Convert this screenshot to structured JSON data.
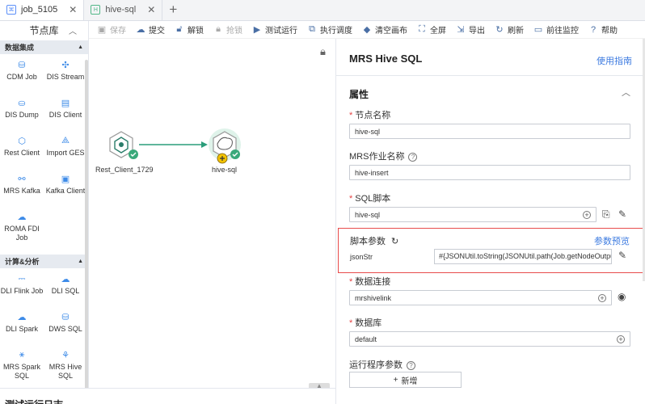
{
  "tabs": [
    {
      "label": "job_5105",
      "icon": "job-icon",
      "active": true
    },
    {
      "label": "hive-sql",
      "icon": "script-icon",
      "active": false
    }
  ],
  "library": {
    "title": "节点库",
    "categories": [
      {
        "name": "数据集成",
        "nodes": [
          "CDM Job",
          "DIS Stream",
          "DIS Dump",
          "DIS Client",
          "Rest Client",
          "Import GES",
          "MRS Kafka",
          "Kafka Client",
          "ROMA FDI Job"
        ]
      },
      {
        "name": "计算&分析",
        "nodes": [
          "DLI Flink Job",
          "DLI SQL",
          "DLI Spark",
          "DWS SQL",
          "MRS Spark SQL",
          "MRS Hive SQL"
        ]
      }
    ]
  },
  "toolbar": {
    "save": "保存",
    "submit": "提交",
    "unlock": "解锁",
    "grab_lock": "抢锁",
    "test_run": "测试运行",
    "schedule": "执行调度",
    "clear_canvas": "清空画布",
    "fullscreen": "全屏",
    "export": "导出",
    "refresh": "刷新",
    "monitor": "前往监控",
    "help": "帮助"
  },
  "canvas": {
    "nodes": [
      {
        "label": "Rest_Client_1729"
      },
      {
        "label": "hive-sql"
      }
    ],
    "log_title": "测试运行日志"
  },
  "panel": {
    "title": "MRS Hive SQL",
    "guide_link": "使用指南",
    "section": "属性",
    "node_name_label": "节点名称",
    "node_name_value": "hive-sql",
    "job_name_label": "MRS作业名称",
    "job_name_value": "hive-insert",
    "sql_script_label": "SQL脚本",
    "sql_script_value": "hive-sql",
    "script_params_label": "脚本参数",
    "params_preview": "参数预览",
    "param_key": "jsonStr",
    "param_value": "#{JSONUtil.toString(JSONUtil.path(Job.getNodeOutput(\"F",
    "connection_label": "数据连接",
    "connection_value": "mrshivelink",
    "database_label": "数据库",
    "database_value": "default",
    "runtime_params_label": "运行程序参数",
    "add_button": "新增"
  }
}
